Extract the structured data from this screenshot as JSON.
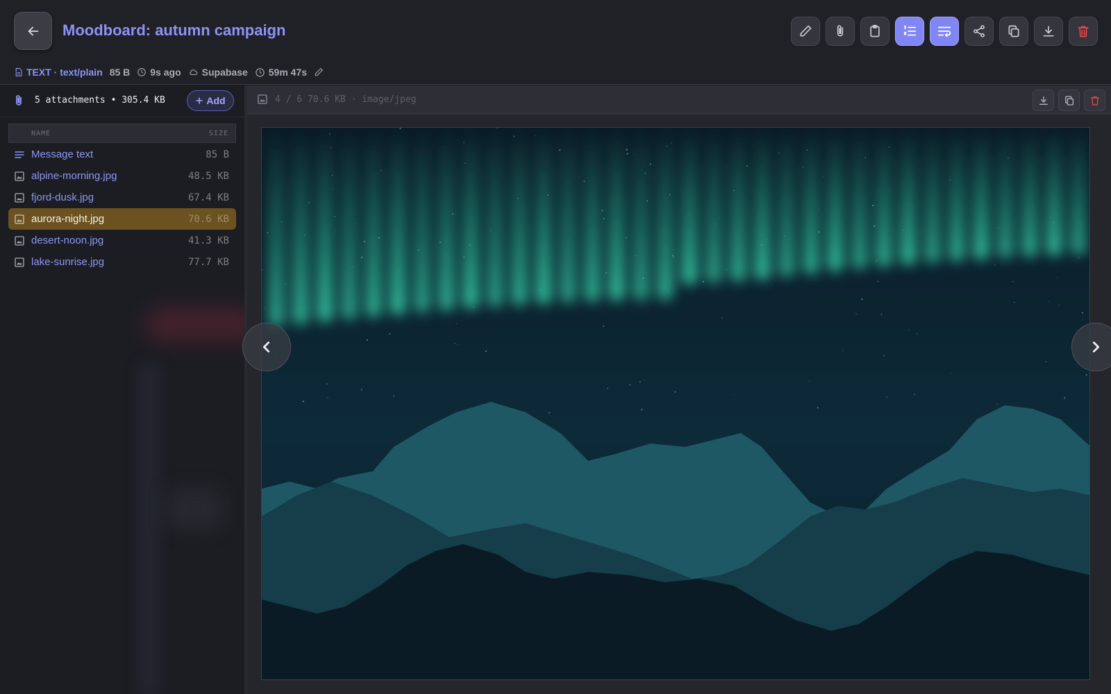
{
  "header": {
    "title": "Moodboard: autumn campaign",
    "toolbar": [
      "edit-icon",
      "attach-icon",
      "clipboard-icon",
      "numbered-list-icon",
      "wrap-icon",
      "share-icon",
      "copy-icon",
      "download-icon",
      "trash-icon"
    ],
    "meta": {
      "type": "TEXT · text/plain",
      "size": "85 B",
      "age": "9s ago",
      "storage": "Supabase",
      "timer": "59m 47s"
    }
  },
  "sidebar": {
    "summary": "5 attachments • 305.4 KB",
    "add_label": "Add",
    "columns": {
      "name": "NAME",
      "size": "SIZE"
    },
    "items": [
      {
        "name": "Message text",
        "size": "85 B",
        "icon": "text-lines-icon"
      },
      {
        "name": "alpine-morning.jpg",
        "size": "48.5 KB",
        "icon": "image-icon"
      },
      {
        "name": "fjord-dusk.jpg",
        "size": "67.4 KB",
        "icon": "image-icon"
      },
      {
        "name": "aurora-night.jpg",
        "size": "70.6 KB",
        "icon": "image-icon",
        "selected": true
      },
      {
        "name": "desert-noon.jpg",
        "size": "41.3 KB",
        "icon": "image-icon"
      },
      {
        "name": "lake-sunrise.jpg",
        "size": "77.7 KB",
        "icon": "image-icon"
      }
    ]
  },
  "viewer": {
    "info": "4 / 6 70.6 KB · image/jpeg",
    "colors": {
      "accent": "#8186f5",
      "danger": "#e5484d",
      "selected": "#6b5220",
      "aurora": "#2ed3a8"
    }
  }
}
